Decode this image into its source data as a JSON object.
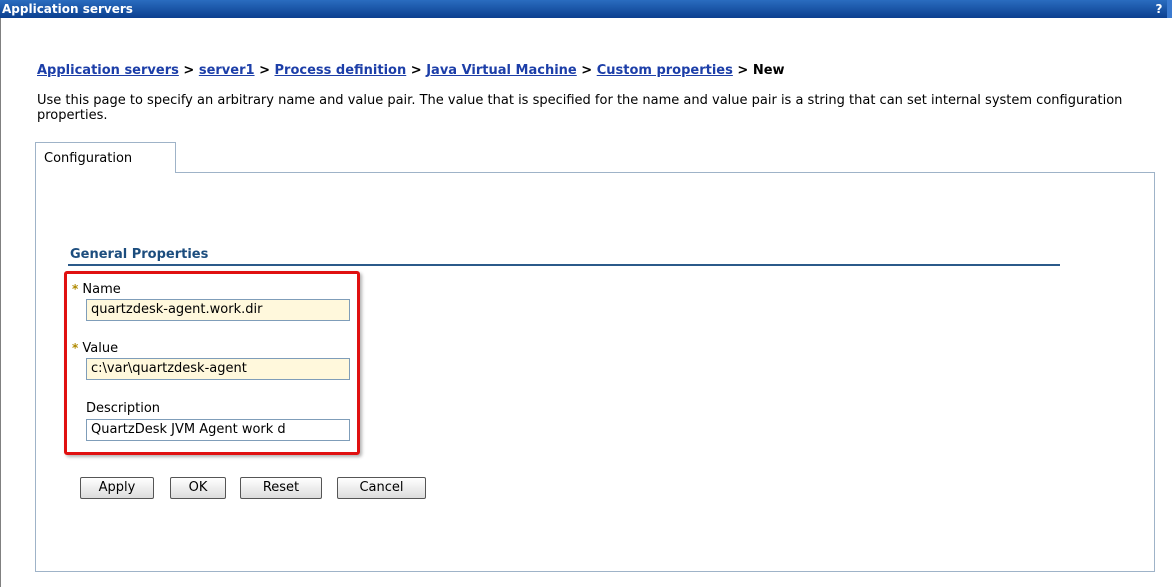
{
  "window": {
    "title": "Application servers",
    "help_label": "?"
  },
  "breadcrumb": {
    "items": [
      "Application servers",
      "server1",
      "Process definition",
      "Java Virtual Machine",
      "Custom properties"
    ],
    "separator": ">",
    "current": "New"
  },
  "description": "Use this page to specify an arbitrary name and value pair. The value that is specified for the name and value pair is a string that can set internal system configuration properties.",
  "tabs": [
    {
      "label": "Configuration"
    }
  ],
  "general_properties": {
    "title": "General Properties",
    "required_marker": "*",
    "name": {
      "label": "Name",
      "value": "quartzdesk-agent.work.dir"
    },
    "value": {
      "label": "Value",
      "value": "c:\\var\\quartzdesk-agent"
    },
    "description": {
      "label": "Description",
      "value": "QuartzDesk JVM Agent work d"
    }
  },
  "buttons": {
    "apply": "Apply",
    "ok": "OK",
    "reset": "Reset",
    "cancel": "Cancel"
  },
  "colors": {
    "title_bar": "#0b3f8f",
    "link": "#1c3ea8",
    "highlight_box": "#e01010",
    "field_bg": "#fff8dc"
  }
}
